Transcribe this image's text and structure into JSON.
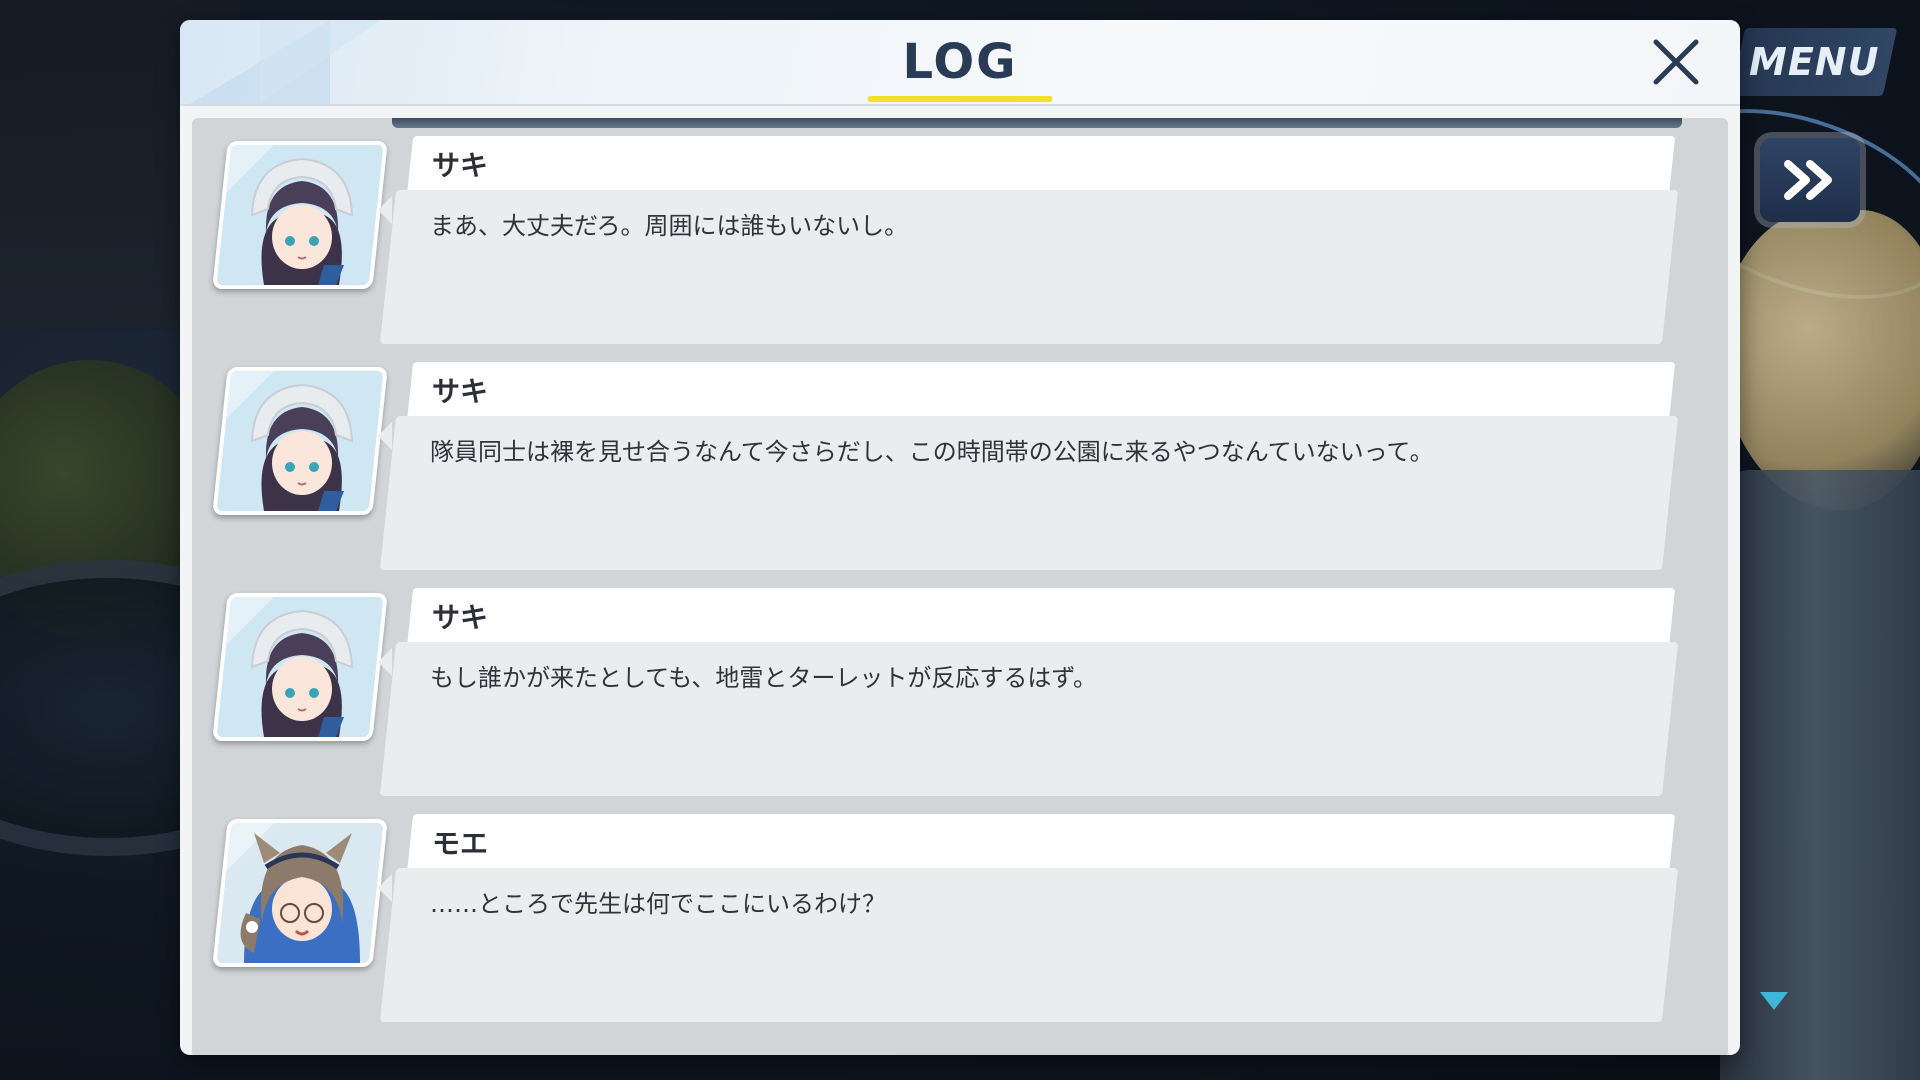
{
  "log": {
    "title": "LOG",
    "entries": [
      {
        "speaker": "サキ",
        "text": "まあ、大丈夫だろ。周囲には誰もいないし。",
        "avatar": "saki-portrait"
      },
      {
        "speaker": "サキ",
        "text": "隊員同士は裸を見せ合うなんて今さらだし、この時間帯の公園に来るやつなんていないって。",
        "avatar": "saki-portrait"
      },
      {
        "speaker": "サキ",
        "text": "もし誰かが来たとしても、地雷とターレットが反応するはず。",
        "avatar": "saki-portrait"
      },
      {
        "speaker": "モエ",
        "text": "……ところで先生は何でここにいるわけ？",
        "avatar": "moe-portrait"
      }
    ]
  },
  "controls": {
    "menu_label": "MENU",
    "auto_icon": "double-chevron-right-icon",
    "close_icon": "close-icon",
    "down_icon": "down-triangle-icon"
  },
  "colors": {
    "title": "#2a3b55",
    "title_underline": "#f3df2e",
    "bubble_name_bg": "#ffffff",
    "bubble_body_bg": "#ebecee",
    "list_bg": "#d2d5d8"
  }
}
